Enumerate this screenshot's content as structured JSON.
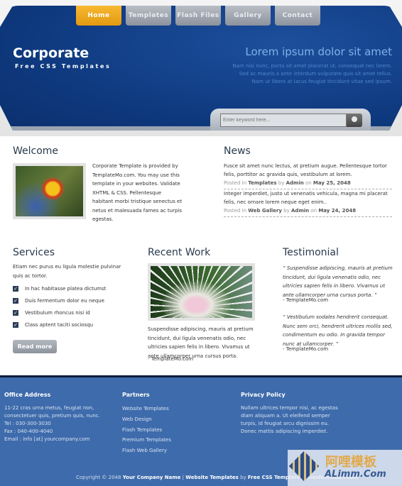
{
  "nav": [
    "Home",
    "Templates",
    "Flash Files",
    "Gallery",
    "Contact"
  ],
  "header": {
    "title": "Corporate",
    "slogan": "Free CSS Templates",
    "headline": "Lorem ipsum dolor sit amet",
    "lines": [
      "Nam nisi nunc, porta sit amet placerat ut, consequat nec lorem.",
      "Sed ac mauris a ante interdum vulputate quis sit amet tellus.",
      "Nam ut libero at lacus feugiat tincidunt vitae sed ipsum."
    ]
  },
  "search": {
    "placeholder": "Enter keyword here...",
    "icon": "search-icon"
  },
  "welcome": {
    "title": "Welcome",
    "text": "Corporate Template is provided by TemplateMo.com. You may use this template in your websites. Validate XHTML & CSS. Pellentesque habitant morbi tristique senectus et netus et malesuada fames ac turpis egestas."
  },
  "news": {
    "title": "News",
    "items": [
      {
        "text": "Fusce sit amet nunc lectus, at pretium augue. Pellentesque tortor felis, porttitor ac gravida quis, vestibulum at lorem.",
        "posted": "Posted in",
        "cat": "Templates",
        "by": "by",
        "author": "Admin",
        "on": "on",
        "date": "May 25, 2048"
      },
      {
        "text": "Integer imperdiet, justo ut venenatis vehicula, magna mi placerat felis, nec ornare lorem neque eget enim..",
        "posted": "Posted in",
        "cat": "Web Gallery",
        "by": "by",
        "author": "Admin",
        "on": "on",
        "date": "May 24, 2048"
      }
    ]
  },
  "services": {
    "title": "Services",
    "intro": "Etiam nec purus eu ligula molestie pulvinar quis ac tortor.",
    "items": [
      "In hac habitasse platea dictumst",
      "Duis fermentum dolor eu neque",
      "Vestibulum rhoncus nisi id",
      "Class aptent taciti sociosqu"
    ],
    "button": "Read more"
  },
  "recent": {
    "title": "Recent Work",
    "text": "Suspendisse adipiscing, mauris at pretium tincidunt, dui ligula venenatis odio, nec ultricies sapien felis in libero. Vivamus ut ante ullamcorper urna cursus porta.",
    "credit": "- TemplateMo.com"
  },
  "testimonial": {
    "title": "Testimonial",
    "items": [
      {
        "quote": "Suspendisse adipiscing, mauris at pretium tincidunt, dui ligula venenatis odio, nec ultricies sapien felis in libero. Vivamus ut ante ullamcorper urna cursus porta.",
        "credit": "- TemplateMo.com"
      },
      {
        "quote": "Vestibulum sodales hendrerit consequat. Nunc sem orci, hendrerit ultrices mollis sed, condimentum eu odio. In gravida tempor nunc at ullamcorper.",
        "credit": "- TemplateMo.com"
      }
    ]
  },
  "footer": {
    "office": {
      "title": "Office Address",
      "lines": [
        "11-22 cras urna metus, feugiat non,",
        "consectetuer quis, pretium quis, nunc.",
        "Tel : 030-300-3030",
        "Fax : 040-400-4040",
        "Email : info [at] yourcompany.com"
      ]
    },
    "partners": {
      "title": "Partners",
      "links": [
        "Website Templates",
        "Web Design",
        "Flash Templates",
        "Premium Templates",
        "Flash Web Gallery"
      ]
    },
    "privacy": {
      "title": "Privacy Policy",
      "text": "Nullam ultrices tempor nisi, ac egestas diam aliquam a. Ut eleifend semper turpis, id feugiat arcu dignissim eu. Donec mattis adipiscing imperdiet."
    },
    "copyright": {
      "prefix": "Copyright © 2048",
      "company": "Your Company Name",
      "sep": "|",
      "templates": "Website Templates",
      "by": "by",
      "source": "Free CSS Templates-mianfeimoban.com"
    }
  },
  "watermark": {
    "cn": "阿哩模板",
    "en": "ALimm.Com"
  },
  "colors": {
    "accent": "#f2a822",
    "header_blue": "#0f3a80",
    "footer_blue": "#3e6bab"
  }
}
